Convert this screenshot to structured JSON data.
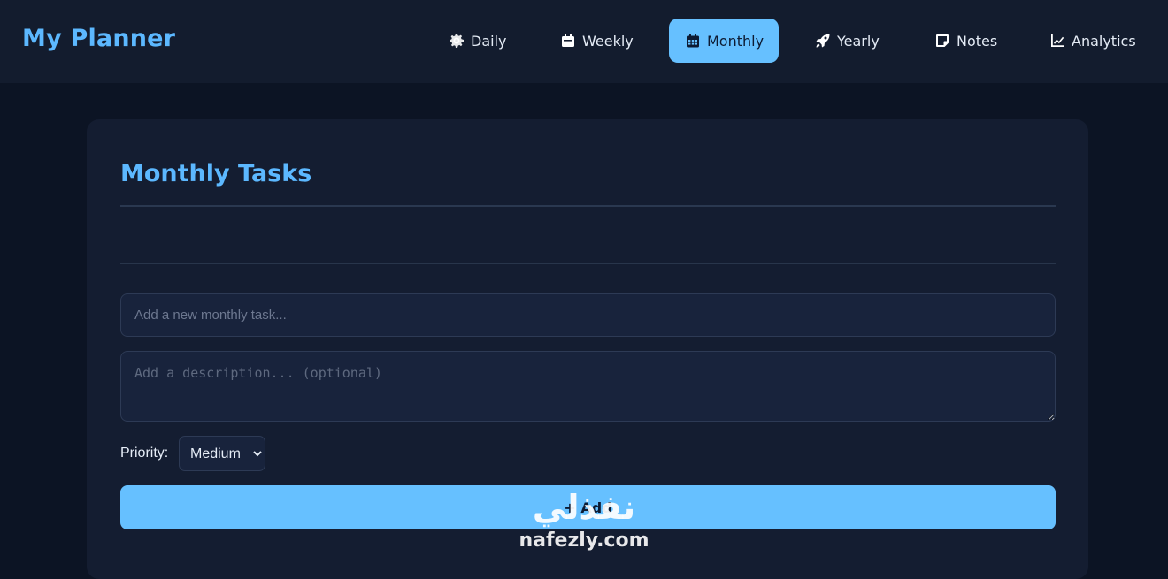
{
  "app": {
    "title": "My Planner"
  },
  "nav": {
    "items": [
      {
        "label": "Daily",
        "icon": "gear-icon",
        "active": false
      },
      {
        "label": "Weekly",
        "icon": "calendar-day-icon",
        "active": false
      },
      {
        "label": "Monthly",
        "icon": "calendar-grid-icon",
        "active": true
      },
      {
        "label": "Yearly",
        "icon": "rocket-icon",
        "active": false
      },
      {
        "label": "Notes",
        "icon": "sticky-note-icon",
        "active": false
      },
      {
        "label": "Analytics",
        "icon": "line-chart-icon",
        "active": false
      }
    ]
  },
  "main": {
    "title": "Monthly Tasks",
    "task_input": {
      "placeholder": "Add a new monthly task...",
      "value": ""
    },
    "description_input": {
      "placeholder": "Add a description... (optional)",
      "value": ""
    },
    "priority": {
      "label": "Priority:",
      "selected": "Medium"
    },
    "add_button": {
      "label": "+ Add"
    }
  },
  "watermark": {
    "arabic": "نفذلي",
    "latin": "nafezly.com"
  },
  "colors": {
    "accent": "#5cb8ff",
    "button": "#66c0ff",
    "background": "#0c1424",
    "card": "#141d31",
    "topbar": "#131c2e"
  }
}
